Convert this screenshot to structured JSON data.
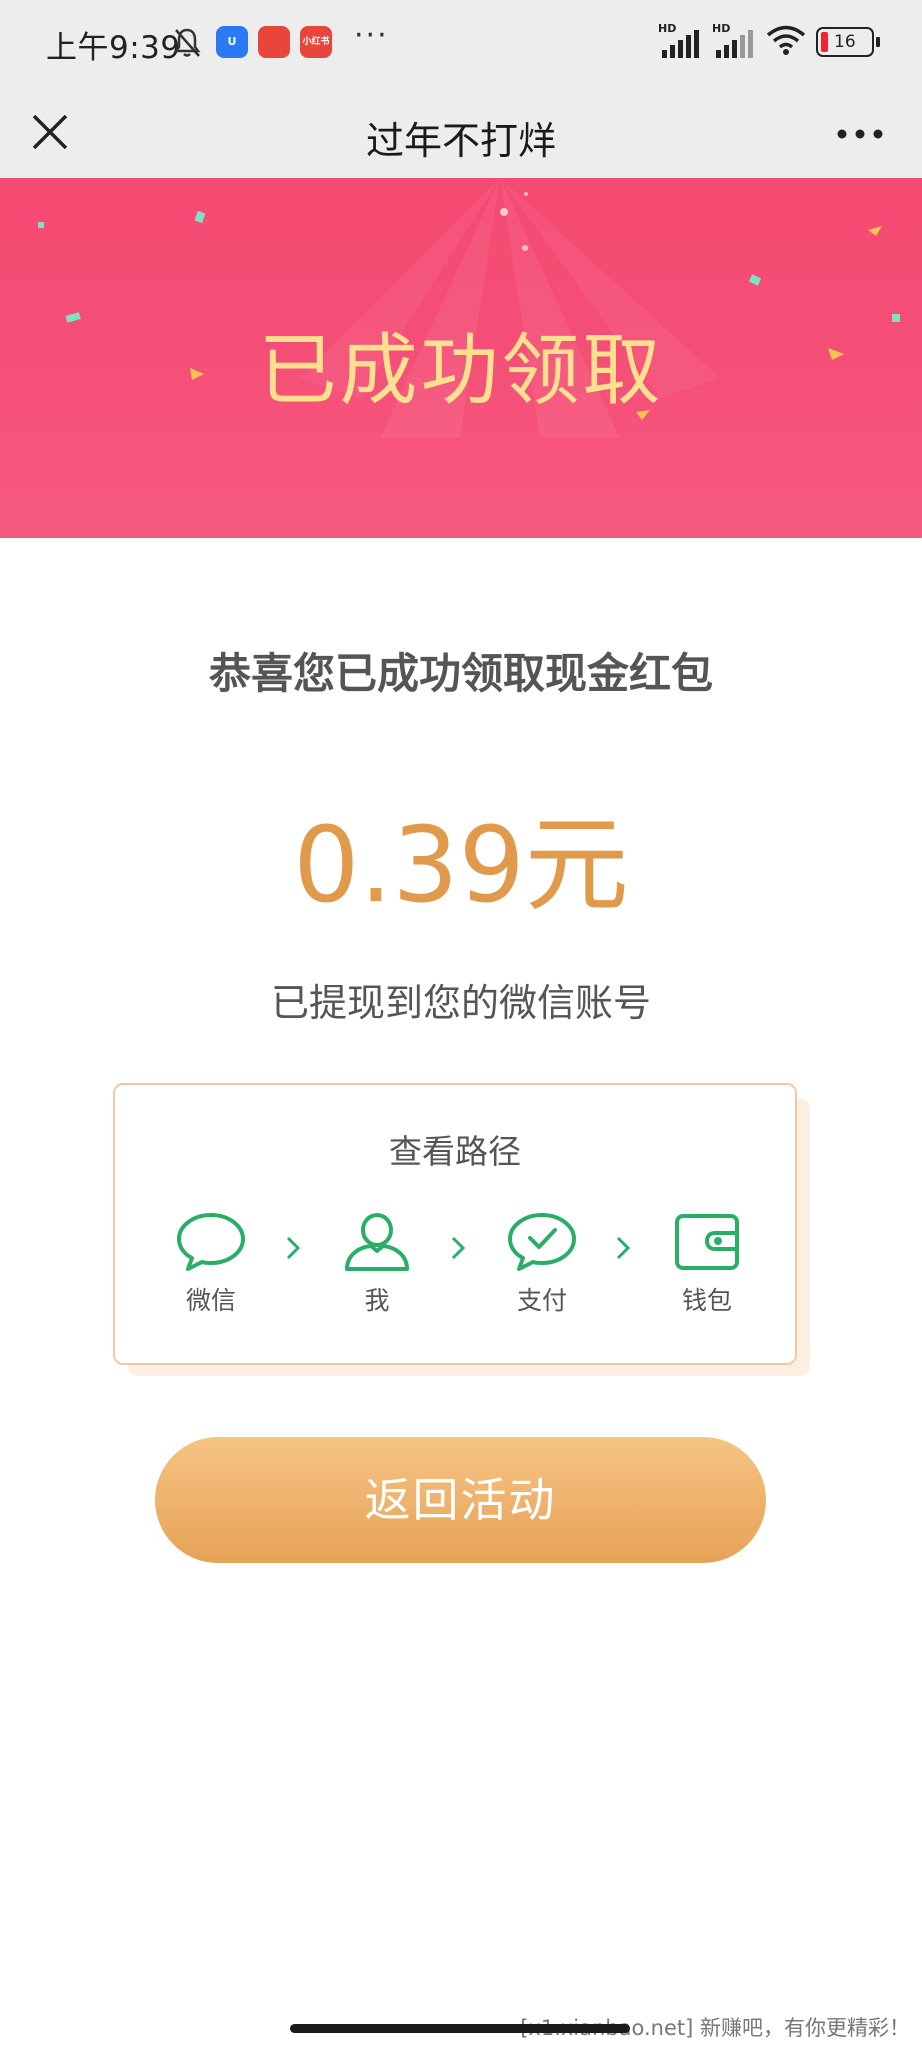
{
  "status_bar": {
    "time": "上午9:39",
    "app1_label": "U",
    "app2_label": "",
    "app3_label": "小红书",
    "more": "···",
    "signal1_label": "HD",
    "signal2_label": "HD",
    "battery": "16",
    "battery_color": "#e22233"
  },
  "nav": {
    "title": "过年不打烊",
    "close_icon": "close-icon",
    "more_icon": "more-icon"
  },
  "banner": {
    "title": "已成功领取",
    "background_color": "#f5416a",
    "title_color": "#ffe08f"
  },
  "main": {
    "congrats": "恭喜您已成功领取现金红包",
    "amount": "0.39元",
    "amount_color": "#e19a4c",
    "withdraw_note": "已提现到您的微信账号"
  },
  "path_card": {
    "title": "查看路径",
    "steps": [
      {
        "label": "微信",
        "icon": "chat-bubble-icon"
      },
      {
        "label": "我",
        "icon": "person-icon"
      },
      {
        "label": "支付",
        "icon": "payment-check-icon"
      },
      {
        "label": "钱包",
        "icon": "wallet-icon"
      }
    ],
    "icon_color": "#2aae67"
  },
  "return_button": {
    "label": "返回活动",
    "color": "#e6a257"
  },
  "watermark": "[x1.xianbao.net] 新赚吧，有你更精彩！"
}
